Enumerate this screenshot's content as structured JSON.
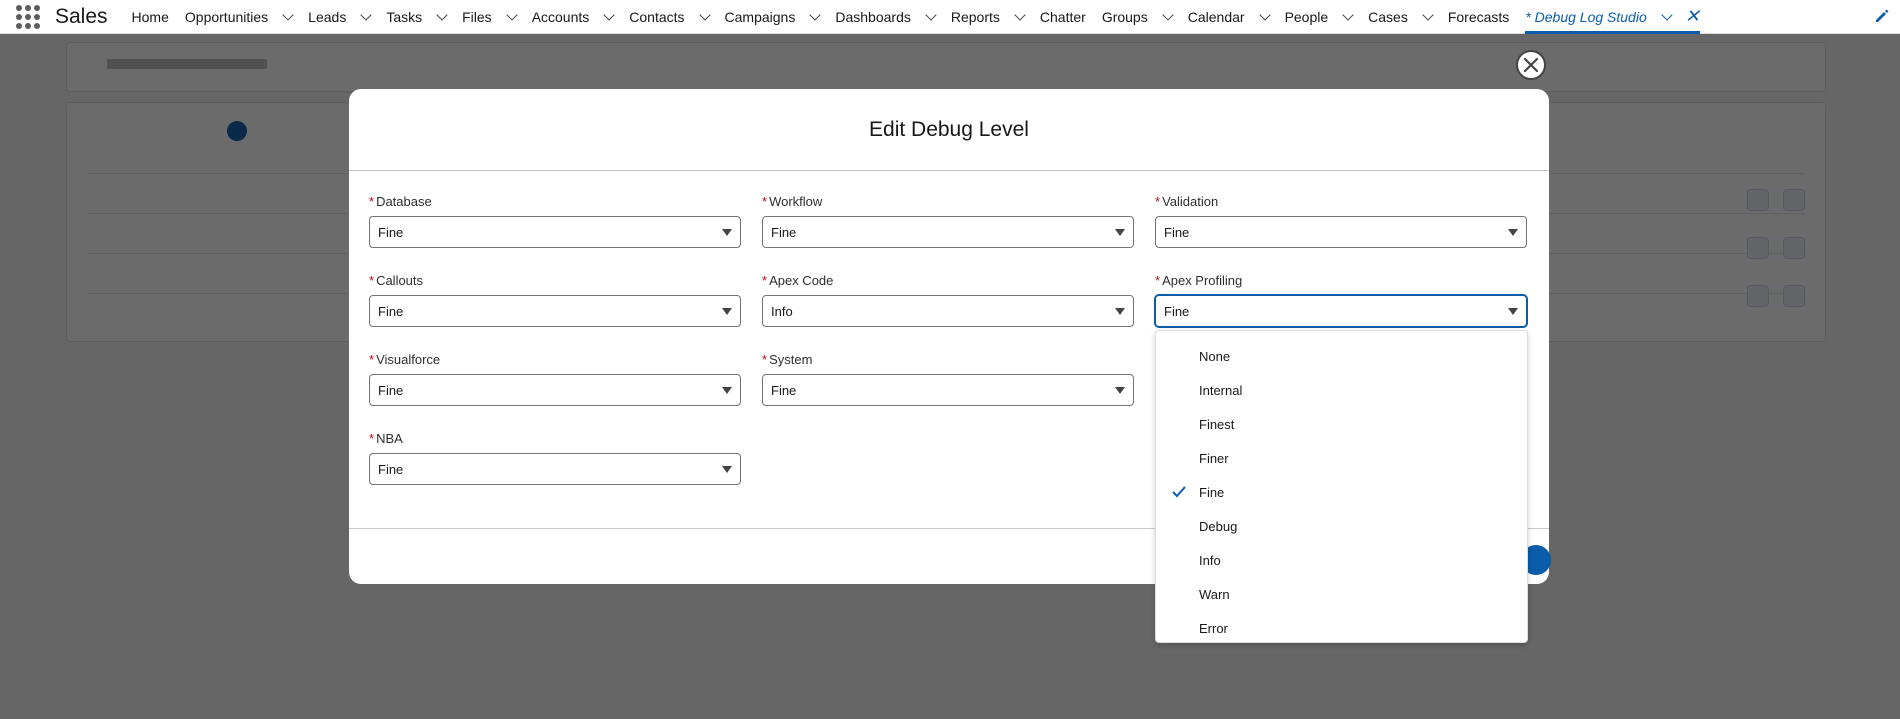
{
  "app": {
    "name": "Sales"
  },
  "nav": {
    "items": [
      {
        "label": "Home",
        "has_menu": false
      },
      {
        "label": "Opportunities",
        "has_menu": true
      },
      {
        "label": "Leads",
        "has_menu": true
      },
      {
        "label": "Tasks",
        "has_menu": true
      },
      {
        "label": "Files",
        "has_menu": true
      },
      {
        "label": "Accounts",
        "has_menu": true
      },
      {
        "label": "Contacts",
        "has_menu": true
      },
      {
        "label": "Campaigns",
        "has_menu": true
      },
      {
        "label": "Dashboards",
        "has_menu": true
      },
      {
        "label": "Reports",
        "has_menu": true
      },
      {
        "label": "Chatter",
        "has_menu": false
      },
      {
        "label": "Groups",
        "has_menu": true
      },
      {
        "label": "Calendar",
        "has_menu": true
      },
      {
        "label": "People",
        "has_menu": true
      },
      {
        "label": "Cases",
        "has_menu": true
      },
      {
        "label": "Forecasts",
        "has_menu": false
      }
    ],
    "active_tab": {
      "label": "* Debug Log Studio"
    }
  },
  "modal": {
    "title": "Edit Debug Level",
    "fields": [
      {
        "label": "Database",
        "value": "Fine"
      },
      {
        "label": "Workflow",
        "value": "Fine"
      },
      {
        "label": "Validation",
        "value": "Fine"
      },
      {
        "label": "Callouts",
        "value": "Fine"
      },
      {
        "label": "Apex Code",
        "value": "Info"
      },
      {
        "label": "Apex Profiling",
        "value": "Fine"
      },
      {
        "label": "Visualforce",
        "value": "Fine"
      },
      {
        "label": "System",
        "value": "Fine"
      },
      {
        "label": "NBA",
        "value": "Fine"
      }
    ],
    "required_marker": "*"
  },
  "dropdown": {
    "options": [
      "None",
      "Internal",
      "Finest",
      "Finer",
      "Fine",
      "Debug",
      "Info",
      "Warn",
      "Error"
    ],
    "selected": "Fine"
  },
  "colors": {
    "accent": "#0b5cab",
    "required": "#ba0517"
  }
}
